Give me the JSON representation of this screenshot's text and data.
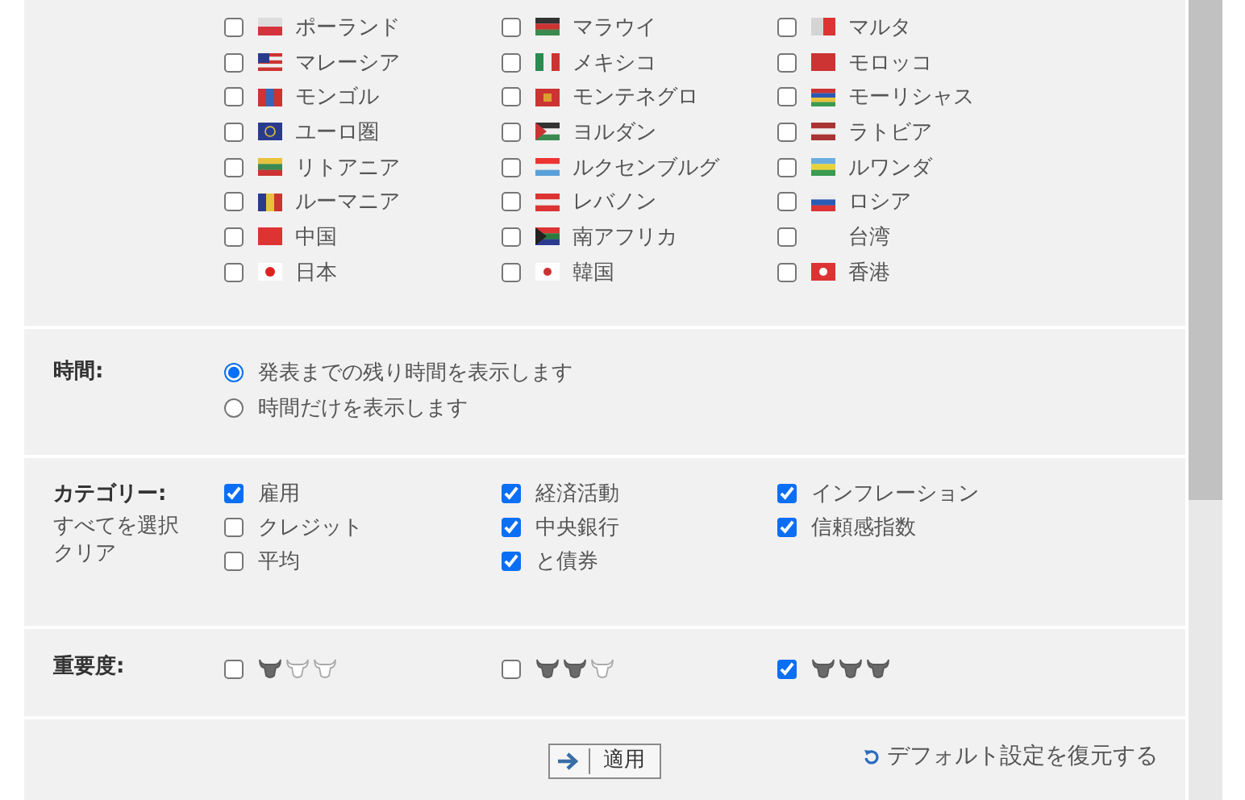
{
  "countries": [
    {
      "label": "ポーランド",
      "checked": false
    },
    {
      "label": "マラウイ",
      "checked": false
    },
    {
      "label": "マルタ",
      "checked": false
    },
    {
      "label": "マレーシア",
      "checked": false
    },
    {
      "label": "メキシコ",
      "checked": false
    },
    {
      "label": "モロッコ",
      "checked": false
    },
    {
      "label": "モンゴル",
      "checked": false
    },
    {
      "label": "モンテネグロ",
      "checked": false
    },
    {
      "label": "モーリシャス",
      "checked": false
    },
    {
      "label": "ユーロ圏",
      "checked": false
    },
    {
      "label": "ヨルダン",
      "checked": false
    },
    {
      "label": "ラトビア",
      "checked": false
    },
    {
      "label": "リトアニア",
      "checked": false
    },
    {
      "label": "ルクセンブルグ",
      "checked": false
    },
    {
      "label": "ルワンダ",
      "checked": false
    },
    {
      "label": "ルーマニア",
      "checked": false
    },
    {
      "label": "レバノン",
      "checked": false
    },
    {
      "label": "ロシア",
      "checked": false
    },
    {
      "label": "中国",
      "checked": false
    },
    {
      "label": "南アフリカ",
      "checked": false
    },
    {
      "label": "台湾",
      "checked": false
    },
    {
      "label": "日本",
      "checked": false
    },
    {
      "label": "韓国",
      "checked": false
    },
    {
      "label": "香港",
      "checked": false
    }
  ],
  "time": {
    "label": "時間:",
    "options": [
      {
        "label": "発表までの残り時間を表示します",
        "selected": true
      },
      {
        "label": "時間だけを表示します",
        "selected": false
      }
    ]
  },
  "category": {
    "label": "カテゴリー:",
    "links": [
      "すべてを選択",
      "クリア"
    ],
    "options": [
      {
        "label": "雇用",
        "checked": true
      },
      {
        "label": "経済活動",
        "checked": true
      },
      {
        "label": "インフレーション",
        "checked": true
      },
      {
        "label": "クレジット",
        "checked": false
      },
      {
        "label": "中央銀行",
        "checked": true
      },
      {
        "label": "信頼感指数",
        "checked": true
      },
      {
        "label": "平均",
        "checked": false
      },
      {
        "label": "と債券",
        "checked": true
      }
    ]
  },
  "importance": {
    "label": "重要度:",
    "options": [
      {
        "stars": 1,
        "checked": false
      },
      {
        "stars": 2,
        "checked": false
      },
      {
        "stars": 3,
        "checked": true
      }
    ]
  },
  "apply_button": "適用",
  "restore_link": "デフォルト設定を復元する"
}
